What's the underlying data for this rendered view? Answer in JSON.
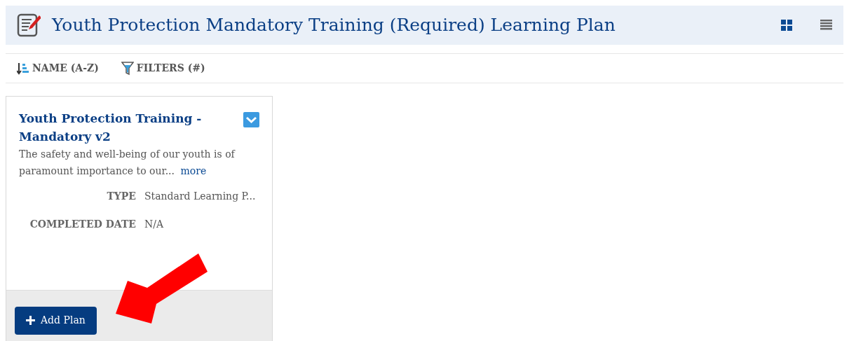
{
  "header": {
    "title": "Youth Protection Mandatory Training (Required) Learning Plan",
    "views": [
      {
        "kind": "grid",
        "selected": true
      },
      {
        "kind": "list",
        "selected": false
      }
    ]
  },
  "toolbar": {
    "sort": "NAME (A-Z)",
    "filters": "FILTERS (#)"
  },
  "card": {
    "title": "Youth Protection Training - Mandatory v2",
    "description": "The safety and well-being of our youth is of paramount importance to our...",
    "more": "more",
    "fields": [
      {
        "label": "TYPE",
        "value": "Standard Learning P..."
      },
      {
        "label": "COMPLETED DATE",
        "value": "N/A"
      }
    ],
    "button": "Add Plan"
  }
}
